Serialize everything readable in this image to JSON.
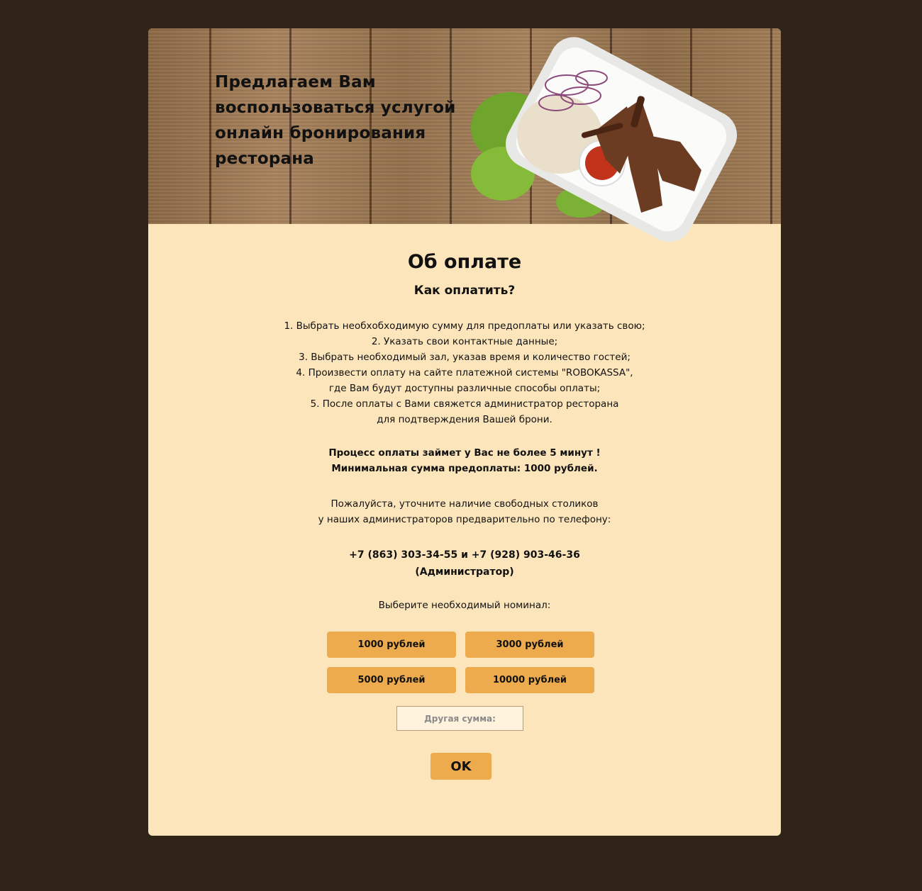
{
  "banner": {
    "title": "Предлагаем Вам воспользоваться услугой онлайн бронирования ресторана"
  },
  "payment": {
    "heading": "Об оплате",
    "subheading": "Как оплатить?",
    "steps": [
      "1. Выбрать необхобходимую сумму для предоплаты или указать свою;",
      "2. Указать свои контактные данные;",
      "3. Выбрать необходимый зал, указав время и количество гостей;",
      "4. Произвести оплату на сайте платежной системы \"ROBOKASSA\",",
      "где Вам будут доступны различные способы оплаты;",
      "5. После оплаты с Вами свяжется администратор ресторана",
      "для подтверждения Вашей брони."
    ],
    "highlights": [
      "Процесс оплаты займет у Вас не более 5 минут !",
      "Минимальная сумма предоплаты: 1000 рублей."
    ],
    "note": [
      "Пожалуйста, уточните наличие свободных столиков",
      "у наших администраторов предварительно по телефону:"
    ],
    "phones": "+7 (863) 303-34-55 и +7 (928) 903-46-36",
    "phones_role": "(Администратор)",
    "choose_label": "Выберите необходимый номинал:",
    "amounts": [
      "1000 рублей",
      "3000 рублей",
      "5000 рублей",
      "10000 рублей"
    ],
    "other_placeholder": "Другая сумма:",
    "ok_label": "OK"
  },
  "colors": {
    "page_background": "#302418",
    "card_background": "#fce5ba",
    "button": "#edab4d"
  }
}
